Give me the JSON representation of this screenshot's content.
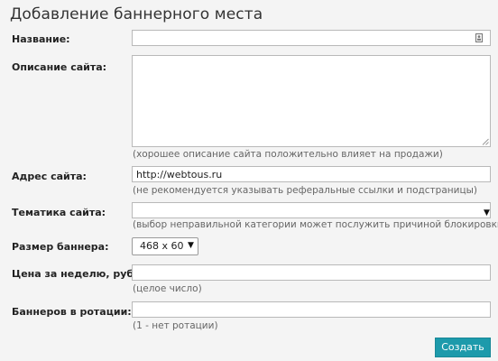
{
  "title": "Добавление баннерного места",
  "form": {
    "name": {
      "label": "Название:",
      "value": ""
    },
    "description": {
      "label": "Описание сайта:",
      "value": "",
      "hint": "(хорошее описание сайта положительно влияет на продажи)"
    },
    "url": {
      "label": "Адрес сайта:",
      "value": "http://webtous.ru",
      "hint": "(не рекомендуется указывать реферальные ссылки и подстраницы)"
    },
    "topic": {
      "label": "Тематика сайта:",
      "value": "",
      "hint": "(выбор неправильной категории может послужить причиной блокировки)"
    },
    "banner_size": {
      "label": "Размер баннера:",
      "value": "468 x 60"
    },
    "price": {
      "label": "Цена за неделю, руб.:",
      "value": "",
      "hint": "(целое число)"
    },
    "rotation": {
      "label": "Баннеров в ротации:",
      "value": "",
      "hint": "(1 - нет ротации)"
    },
    "submit_label": "Создать"
  },
  "icons": {
    "name_field": "contact-card-icon",
    "topic_arrow": "dropdown-arrow-icon",
    "size_arrow": "dropdown-arrow-icon",
    "textarea_grip": "resize-grip-icon"
  },
  "colors": {
    "accent": "#1d9aab",
    "background": "#f4f4f4",
    "border": "#b9b9b9"
  }
}
